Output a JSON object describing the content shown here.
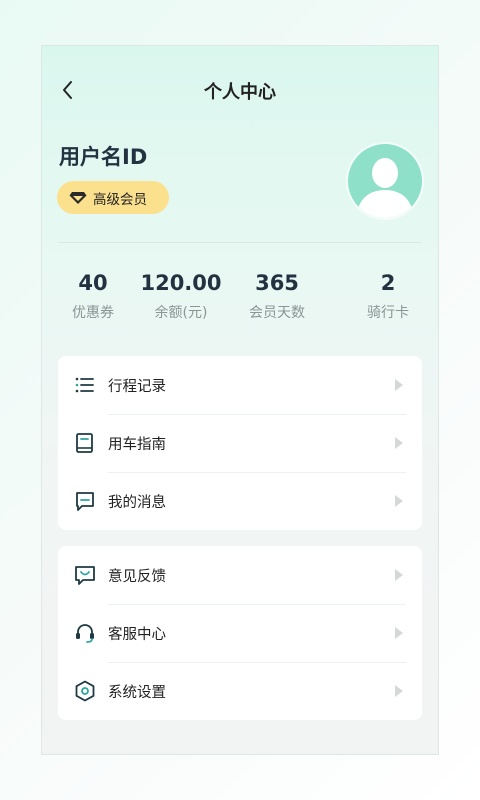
{
  "header": {
    "title": "个人中心"
  },
  "profile": {
    "username": "用户名ID",
    "member_badge": "高级会员"
  },
  "stats": [
    {
      "value": "40",
      "label": "优惠券"
    },
    {
      "value": "120.00",
      "label": "余额(元)"
    },
    {
      "value": "365",
      "label": "会员天数"
    },
    {
      "value": "2",
      "label": "骑行卡"
    }
  ],
  "menu_group_1": [
    {
      "label": "行程记录",
      "icon": "list-icon"
    },
    {
      "label": "用车指南",
      "icon": "book-icon"
    },
    {
      "label": "我的消息",
      "icon": "message-icon"
    }
  ],
  "menu_group_2": [
    {
      "label": "意见反馈",
      "icon": "feedback-icon"
    },
    {
      "label": "客服中心",
      "icon": "headset-icon"
    },
    {
      "label": "系统设置",
      "icon": "settings-icon"
    }
  ],
  "colors": {
    "accent": "#2ea6a0",
    "icon_dark": "#1f3a45",
    "badge_bg": "#fbe08d",
    "avatar_bg": "#8ee0c8",
    "arrow": "#d4d9d8"
  }
}
